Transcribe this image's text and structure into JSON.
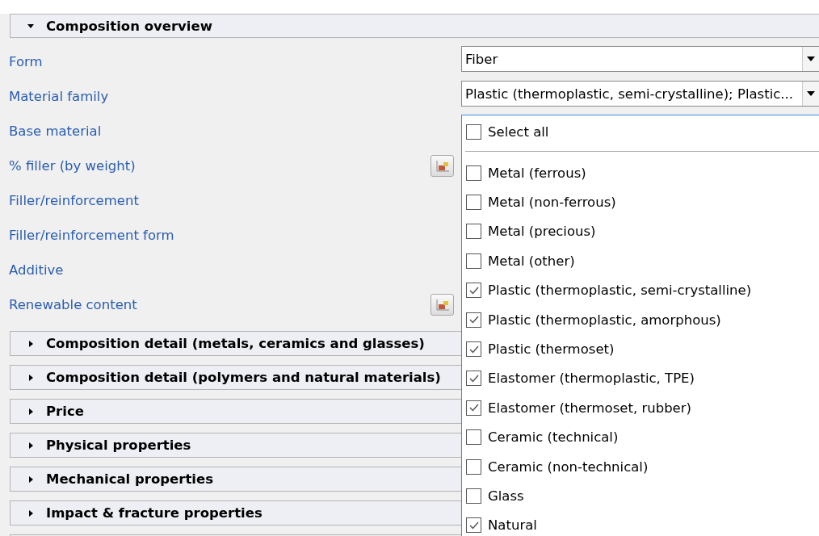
{
  "overview": {
    "title": "Composition overview",
    "expanded": true,
    "rows": [
      {
        "label": "Form",
        "kind": "dropdown",
        "value": "Fiber"
      },
      {
        "label": "Material family",
        "kind": "dropdown",
        "value": "Plastic (thermoplastic, semi-crystalline); Plastic..."
      },
      {
        "label": "Base material",
        "kind": "text"
      },
      {
        "label": "% filler (by weight)",
        "kind": "button"
      },
      {
        "label": "Filler/reinforcement",
        "kind": "text"
      },
      {
        "label": "Filler/reinforcement form",
        "kind": "text"
      },
      {
        "label": "Additive",
        "kind": "text"
      },
      {
        "label": "Renewable content",
        "kind": "button"
      }
    ]
  },
  "sections": [
    {
      "title": "Composition detail (metals, ceramics and glasses)",
      "expanded": false
    },
    {
      "title": "Composition detail (polymers and natural materials)",
      "expanded": false
    },
    {
      "title": "Price",
      "expanded": false
    },
    {
      "title": "Physical properties",
      "expanded": false
    },
    {
      "title": "Mechanical properties",
      "expanded": false
    },
    {
      "title": "Impact & fracture properties",
      "expanded": false
    }
  ],
  "popup": {
    "select_all": {
      "label": "Select all",
      "checked": false
    },
    "options": [
      {
        "label": "Metal (ferrous)",
        "checked": false
      },
      {
        "label": "Metal (non-ferrous)",
        "checked": false
      },
      {
        "label": "Metal (precious)",
        "checked": false
      },
      {
        "label": "Metal (other)",
        "checked": false
      },
      {
        "label": "Plastic (thermoplastic, semi-crystalline)",
        "checked": true
      },
      {
        "label": "Plastic (thermoplastic, amorphous)",
        "checked": true
      },
      {
        "label": "Plastic (thermoset)",
        "checked": true
      },
      {
        "label": "Elastomer (thermoplastic, TPE)",
        "checked": true
      },
      {
        "label": "Elastomer (thermoset, rubber)",
        "checked": true
      },
      {
        "label": "Ceramic (technical)",
        "checked": false
      },
      {
        "label": "Ceramic (non-technical)",
        "checked": false
      },
      {
        "label": "Glass",
        "checked": false
      },
      {
        "label": "Natural",
        "checked": true
      }
    ]
  }
}
